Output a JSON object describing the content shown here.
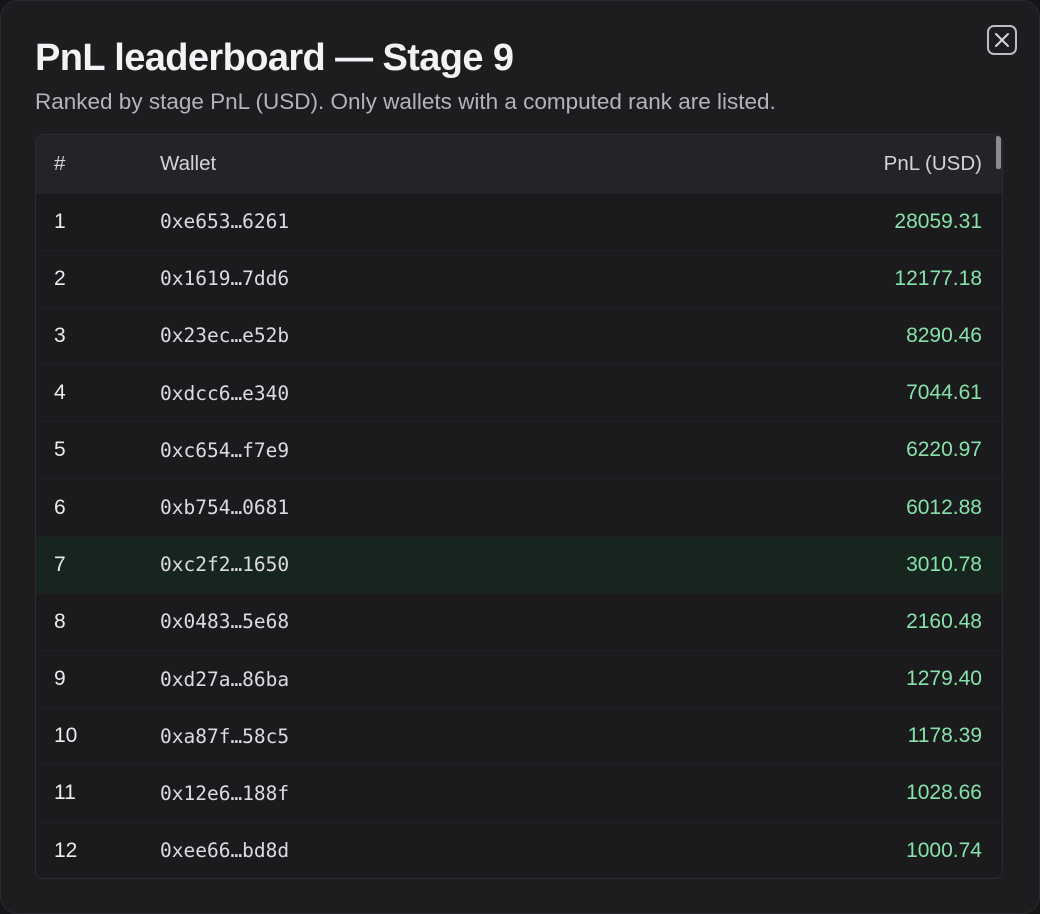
{
  "modal": {
    "title": "PnL leaderboard — Stage 9",
    "subtitle": "Ranked by stage PnL (USD). Only wallets with a computed rank are listed."
  },
  "table": {
    "headers": {
      "rank": "#",
      "wallet": "Wallet",
      "pnl": "PnL (USD)"
    },
    "highlight_color": "#17251f",
    "positive_color": "#86e2a8",
    "rows": [
      {
        "rank": "1",
        "wallet": "0xe653…6261",
        "pnl": "28059.31"
      },
      {
        "rank": "2",
        "wallet": "0x1619…7dd6",
        "pnl": "12177.18"
      },
      {
        "rank": "3",
        "wallet": "0x23ec…e52b",
        "pnl": "8290.46"
      },
      {
        "rank": "4",
        "wallet": "0xdcc6…e340",
        "pnl": "7044.61"
      },
      {
        "rank": "5",
        "wallet": "0xc654…f7e9",
        "pnl": "6220.97"
      },
      {
        "rank": "6",
        "wallet": "0xb754…0681",
        "pnl": "6012.88"
      },
      {
        "rank": "7",
        "wallet": "0xc2f2…1650",
        "pnl": "3010.78",
        "highlighted": true
      },
      {
        "rank": "8",
        "wallet": "0x0483…5e68",
        "pnl": "2160.48"
      },
      {
        "rank": "9",
        "wallet": "0xd27a…86ba",
        "pnl": "1279.40"
      },
      {
        "rank": "10",
        "wallet": "0xa87f…58c5",
        "pnl": "1178.39"
      },
      {
        "rank": "11",
        "wallet": "0x12e6…188f",
        "pnl": "1028.66"
      },
      {
        "rank": "12",
        "wallet": "0xee66…bd8d",
        "pnl": "1000.74"
      }
    ]
  },
  "close_icon": "close-icon"
}
